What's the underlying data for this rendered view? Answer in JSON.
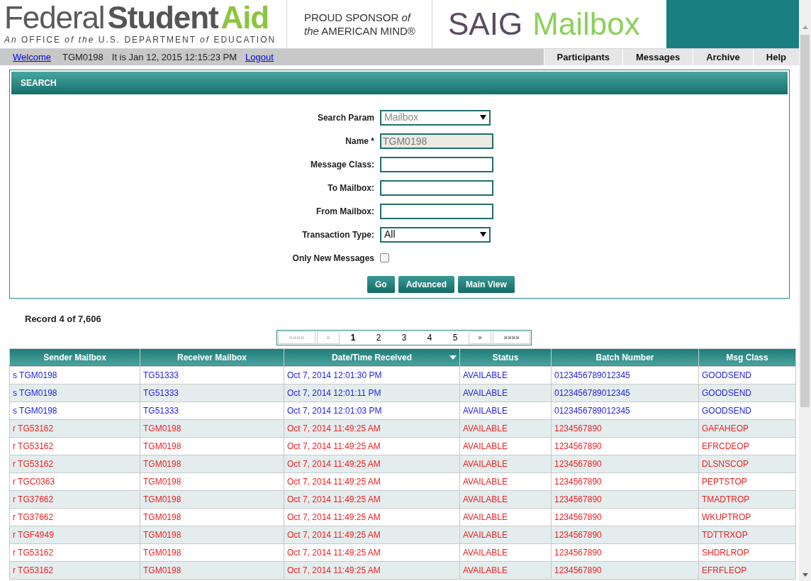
{
  "header": {
    "logo": {
      "word1": "Federal",
      "word2": "Student",
      "word3": "Aid",
      "subtitle": "*An* OFFICE *of the* U.S. DEPARTMENT *of* EDUCATION"
    },
    "sponsor": {
      "line1": "PROUD SPONSOR *of*",
      "line2": "*the* AMERICAN MIND®"
    },
    "app_title": {
      "word1": "SAIG",
      "word2": "Mailbox"
    }
  },
  "nav_bar": {
    "welcome_link": "Welcome",
    "user": "TGM0198",
    "datetime": "It is Jan 12, 2015 12:15:23 PM",
    "logout_link": "Logout",
    "menu": [
      "Participants",
      "Messages",
      "Archive",
      "Help"
    ]
  },
  "search": {
    "title": "SEARCH",
    "fields": [
      {
        "label": "Search Param",
        "kind": "select",
        "value": "Mailbox",
        "disabled": true
      },
      {
        "label": "Name *",
        "kind": "text",
        "value": "TGM0198",
        "disabled": true
      },
      {
        "label": "Message Class:",
        "kind": "text",
        "disabled": false
      },
      {
        "label": "To Mailbox:",
        "kind": "text",
        "disabled": false
      },
      {
        "label": "From Mailbox:",
        "kind": "text",
        "disabled": false
      },
      {
        "label": "Transaction Type:",
        "kind": "select",
        "value": "All",
        "disabled": false
      },
      {
        "label": "Only New Messages",
        "kind": "checkbox",
        "checked": false
      }
    ],
    "buttons": [
      "Go",
      "Advanced",
      "Main View"
    ]
  },
  "record_count": "Record 4 of 7,606",
  "pagination": {
    "first": {
      "label": "««««",
      "disabled": true
    },
    "prev": {
      "label": "«",
      "disabled": true
    },
    "pages": [
      {
        "label": "1",
        "selected": true
      },
      {
        "label": "2",
        "selected": false
      },
      {
        "label": "3",
        "selected": false
      },
      {
        "label": "4",
        "selected": false
      },
      {
        "label": "5",
        "selected": false
      }
    ],
    "next": {
      "label": "»",
      "disabled": false
    },
    "last": {
      "label": "»»»»",
      "disabled": false
    }
  },
  "table": {
    "columns": [
      {
        "label": "Sender Mailbox",
        "sorted": false
      },
      {
        "label": "Receiver Mailbox",
        "sorted": false
      },
      {
        "label": "Date/Time Received",
        "sorted": true
      },
      {
        "label": "Status",
        "sorted": false
      },
      {
        "label": "Batch Number",
        "sorted": false
      },
      {
        "label": "Msg Class",
        "sorted": false
      }
    ],
    "rows": [
      {
        "kind": "sent",
        "cells": [
          "s TGM0198",
          "TG51333",
          "Oct 7, 2014 12:01:30 PM",
          "AVAILABLE",
          "0123456789012345",
          "GOODSEND"
        ]
      },
      {
        "kind": "sent",
        "cells": [
          "s TGM0198",
          "TG51333",
          "Oct 7, 2014 12:01:11 PM",
          "AVAILABLE",
          "0123456789012345",
          "GOODSEND"
        ]
      },
      {
        "kind": "sent",
        "cells": [
          "s TGM0198",
          "TG51333",
          "Oct 7, 2014 12:01:03 PM",
          "AVAILABLE",
          "0123456789012345",
          "GOODSEND"
        ]
      },
      {
        "kind": "received",
        "cells": [
          "r TG53162",
          "TGM0198",
          "Oct 7, 2014 11:49:25 AM",
          "AVAILABLE",
          "1234567890",
          "GAFAHEOP"
        ]
      },
      {
        "kind": "received",
        "cells": [
          "r TG53162",
          "TGM0198",
          "Oct 7, 2014 11:49:25 AM",
          "AVAILABLE",
          "1234567890",
          "EFRCDEOP"
        ]
      },
      {
        "kind": "received",
        "cells": [
          "r TG53162",
          "TGM0198",
          "Oct 7, 2014 11:49:25 AM",
          "AVAILABLE",
          "1234567890",
          "DLSNSCOP"
        ]
      },
      {
        "kind": "received",
        "cells": [
          "r TGC0363",
          "TGM0198",
          "Oct 7, 2014 11:49:25 AM",
          "AVAILABLE",
          "1234567890",
          "PEPTSTOP"
        ]
      },
      {
        "kind": "received",
        "cells": [
          "r TG37662",
          "TGM0198",
          "Oct 7, 2014 11:49:25 AM",
          "AVAILABLE",
          "1234567890",
          "TMADTROP"
        ]
      },
      {
        "kind": "received",
        "cells": [
          "r TG37662",
          "TGM0198",
          "Oct 7, 2014 11:49:25 AM",
          "AVAILABLE",
          "1234567890",
          "WKUPTROP"
        ]
      },
      {
        "kind": "received",
        "cells": [
          "r TGF4949",
          "TGM0198",
          "Oct 7, 2014 11:49:25 AM",
          "AVAILABLE",
          "1234567890",
          "TDTTRXOP"
        ]
      },
      {
        "kind": "received",
        "cells": [
          "r TG53162",
          "TGM0198",
          "Oct 7, 2014 11:49:25 AM",
          "AVAILABLE",
          "1234567890",
          "SHDRLROP"
        ]
      },
      {
        "kind": "received",
        "cells": [
          "r TG53162",
          "TGM0198",
          "Oct 7, 2014 11:49:25 AM",
          "AVAILABLE",
          "1234567890",
          "EFRFLEOP"
        ]
      }
    ]
  }
}
